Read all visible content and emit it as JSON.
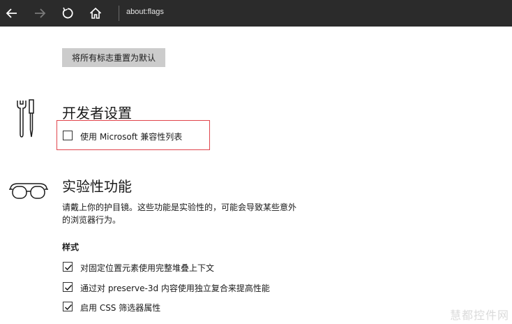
{
  "toolbar": {
    "address": "about:flags",
    "icons": {
      "back": "back-arrow-icon",
      "forward": "forward-arrow-icon",
      "refresh": "refresh-icon",
      "home": "home-icon"
    }
  },
  "reset_label": "将所有标志重置为默认",
  "developer": {
    "title": "开发者设置",
    "icon": "tools-icon",
    "option": {
      "label": "使用 Microsoft 兼容性列表",
      "checked": false
    }
  },
  "experimental": {
    "title": "实验性功能",
    "icon": "goggles-icon",
    "description": "请戴上你的护目镜。这些功能是实验性的，可能会导致某些意外的浏览器行为。",
    "subheading": "样式",
    "options": [
      {
        "label": "对固定位置元素使用完整堆叠上下文",
        "checked": true
      },
      {
        "label": "通过对 preserve-3d 内容使用独立复合来提高性能",
        "checked": true
      },
      {
        "label": "启用 CSS 筛选器属性",
        "checked": true
      }
    ]
  },
  "colors": {
    "toolbar_bg": "#2b2b2b",
    "highlight": "#e0444c",
    "button_bg": "#cccccc"
  },
  "watermark": "慧都控件网"
}
